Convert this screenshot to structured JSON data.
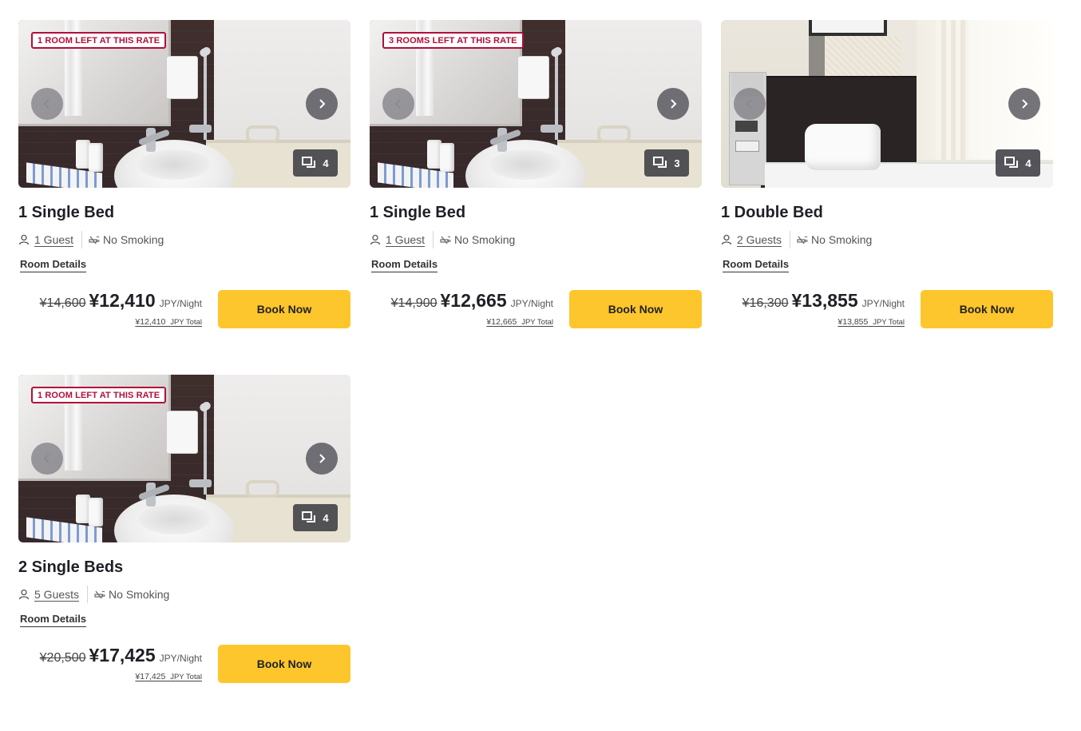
{
  "rooms": [
    {
      "badge": "1 ROOM LEFT AT THIS RATE",
      "photo_type": "bathroom",
      "photo_count": "4",
      "title": "1 Single Bed",
      "guests": "1 Guest",
      "smoking": "No Smoking",
      "details_label": "Room Details",
      "old_price": "¥14,600",
      "price": "¥12,410",
      "unit": "JPY/Night",
      "total_amount": "¥12,410",
      "total_label": "JPY Total",
      "book_label": "Book Now"
    },
    {
      "badge": "3 ROOMS LEFT AT THIS RATE",
      "photo_type": "bathroom",
      "photo_count": "3",
      "title": "1 Single Bed",
      "guests": "1 Guest",
      "smoking": "No Smoking",
      "details_label": "Room Details",
      "old_price": "¥14,900",
      "price": "¥12,665",
      "unit": "JPY/Night",
      "total_amount": "¥12,665",
      "total_label": "JPY Total",
      "book_label": "Book Now"
    },
    {
      "badge": "",
      "photo_type": "bedroom",
      "photo_count": "4",
      "title": "1 Double Bed",
      "guests": "2 Guests",
      "smoking": "No Smoking",
      "details_label": "Room Details",
      "old_price": "¥16,300",
      "price": "¥13,855",
      "unit": "JPY/Night",
      "total_amount": "¥13,855",
      "total_label": "JPY Total",
      "book_label": "Book Now"
    },
    {
      "badge": "1 ROOM LEFT AT THIS RATE",
      "photo_type": "bathroom",
      "photo_count": "4",
      "title": "2 Single Beds",
      "guests": "5 Guests",
      "smoking": "No Smoking",
      "details_label": "Room Details",
      "old_price": "¥20,500",
      "price": "¥17,425",
      "unit": "JPY/Night",
      "total_amount": "¥17,425",
      "total_label": "JPY Total",
      "book_label": "Book Now"
    }
  ],
  "colors": {
    "badge": "#b10f3a",
    "book_button": "#fdc62c",
    "title_text": "#1f1f26"
  },
  "icons": {
    "prev": "chevron-left-icon",
    "next": "chevron-right-icon",
    "photos": "photo-gallery-icon",
    "guest": "person-icon",
    "smoking": "no-smoking-icon"
  }
}
